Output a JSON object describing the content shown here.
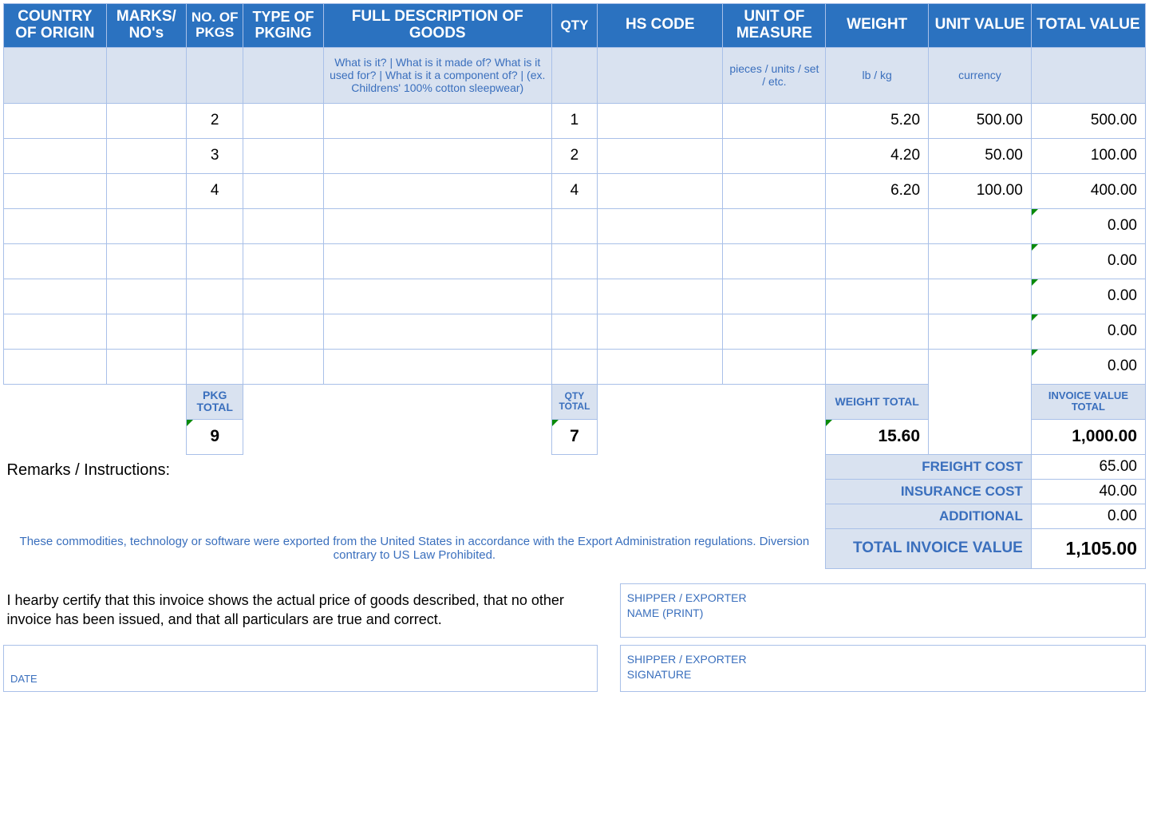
{
  "headers": {
    "country": "COUNTRY OF ORIGIN",
    "marks": "MARKS/ NO's",
    "pkgs": "NO. OF PKGS",
    "pkging": "TYPE OF PKGING",
    "desc": "FULL DESCRIPTION OF GOODS",
    "qty": "QTY",
    "hs": "HS CODE",
    "uom": "UNIT OF MEASURE",
    "weight": "WEIGHT",
    "unitval": "UNIT VALUE",
    "totalval": "TOTAL VALUE"
  },
  "hints": {
    "desc": "What is it? | What is it made of? What is it used for? | What is it a component of? | (ex. Childrens' 100% cotton sleepwear)",
    "uom": "pieces / units / set / etc.",
    "weight": "lb / kg",
    "unitval": "currency"
  },
  "rows": [
    {
      "pkgs": "2",
      "qty": "1",
      "weight": "5.20",
      "unitval": "500.00",
      "totalval": "500.00"
    },
    {
      "pkgs": "3",
      "qty": "2",
      "weight": "4.20",
      "unitval": "50.00",
      "totalval": "100.00"
    },
    {
      "pkgs": "4",
      "qty": "4",
      "weight": "6.20",
      "unitval": "100.00",
      "totalval": "400.00"
    },
    {
      "totalval": "0.00",
      "flag": true
    },
    {
      "totalval": "0.00",
      "flag": true
    },
    {
      "totalval": "0.00",
      "flag": true
    },
    {
      "totalval": "0.00",
      "flag": true
    },
    {
      "totalval": "0.00",
      "flag": true
    }
  ],
  "totals": {
    "pkg_label": "PKG TOTAL",
    "qty_label": "QTY TOTAL",
    "weight_label": "WEIGHT TOTAL",
    "invoice_label": "INVOICE VALUE TOTAL",
    "pkg": "9",
    "qty": "7",
    "weight": "15.60",
    "invoice": "1,000.00"
  },
  "remarks_label": "Remarks / Instructions:",
  "costs": {
    "freight_label": "FREIGHT COST",
    "freight": "65.00",
    "insurance_label": "INSURANCE COST",
    "insurance": "40.00",
    "additional_label": "ADDITIONAL",
    "additional": "0.00",
    "total_label": "TOTAL INVOICE VALUE",
    "total": "1,105.00"
  },
  "disclaimer": "These commodities, technology or software were exported from the United States in accordance with the Export Administration regulations.  Diversion contrary to US Law Prohibited.",
  "certification": "I hearby certify that this invoice shows the actual price of goods described, that no other invoice has been issued, and that all particulars are true and correct.",
  "date_label": "DATE",
  "sig": {
    "name_line1": "SHIPPER / EXPORTER",
    "name_line2": "NAME (PRINT)",
    "sig_line1": "SHIPPER / EXPORTER",
    "sig_line2": "SIGNATURE"
  }
}
